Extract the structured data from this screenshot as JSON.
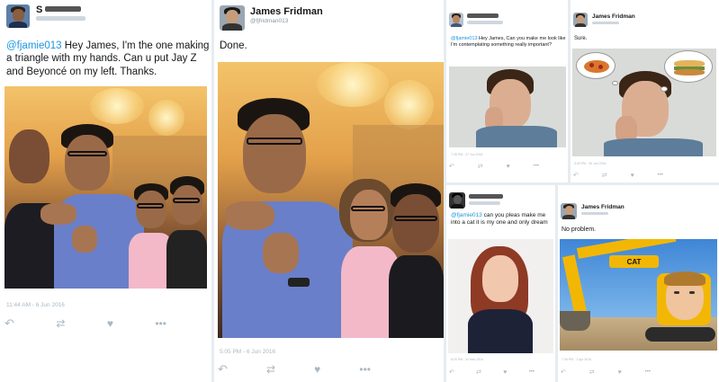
{
  "colors": {
    "mention": "#1b95e0",
    "action_gray": "#aab8c2",
    "divider": "#e6ecf0"
  },
  "tweet1": {
    "name": "S",
    "mention": "@fjamie013",
    "text": " Hey James, I'm the one making a triangle with my hands. Can u put Jay Z and Beyoncé on my left. Thanks.",
    "time": "11:44 AM - 6 Jun 2016",
    "icons": [
      "reply-icon",
      "retweet-icon",
      "like-icon",
      "more-icon"
    ]
  },
  "tweet2": {
    "name": "James Fridman",
    "handle": "@fjfridman013",
    "text": "Done.",
    "time": "5:05 PM - 6 Jun 2016"
  },
  "tweet3": {
    "mention": "@fjamie013",
    "text": " Hey James, Can you make me look like I'm contemplating something really important?",
    "time": "7:35 PM - 27 Jun 2016"
  },
  "tweet4": {
    "name": "James Fridman",
    "text": "Sure.",
    "time": "3:49 PM - 30 Jun 2016"
  },
  "tweet5": {
    "mention": "@fjamie013",
    "text": " can you pleas make me into a cat it is my one and only dream",
    "time": "8:20 PM - 24 Mar 2016"
  },
  "tweet6": {
    "name": "James Fridman",
    "text": "No problem.",
    "time": "7:35 PM - 1 Apr 2016",
    "brand": "CAT"
  }
}
